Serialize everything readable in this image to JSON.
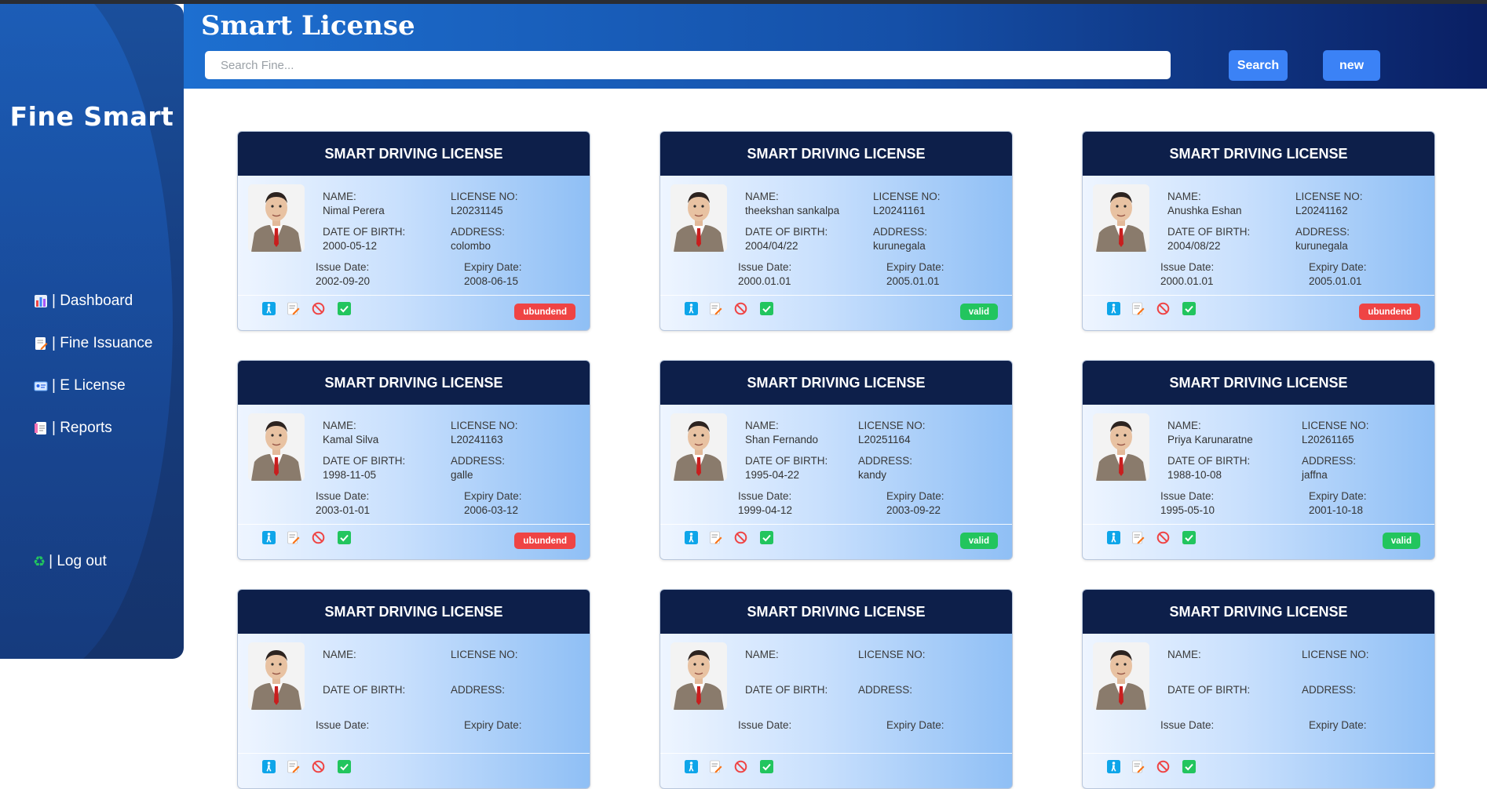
{
  "app": {
    "title": "Smart License"
  },
  "sidebar": {
    "brand": "Fine Smart",
    "items": [
      {
        "label": "| Dashboard",
        "icon": "bar-chart-icon"
      },
      {
        "label": "| Fine Issuance",
        "icon": "document-edit-icon"
      },
      {
        "label": "| E License",
        "icon": "id-card-icon"
      },
      {
        "label": "| Reports",
        "icon": "report-icon"
      }
    ],
    "logout": {
      "label": "| Log out",
      "icon": "recycle-icon"
    }
  },
  "search": {
    "placeholder": "Search Fine...",
    "value": ""
  },
  "buttons": {
    "search": "Search",
    "new": "new"
  },
  "card_labels": {
    "header": "SMART DRIVING LICENSE",
    "name": "NAME:",
    "license_no": "LICENSE NO:",
    "dob": "DATE OF BIRTH:",
    "address": "ADDRESS:",
    "issue": "Issue Date:",
    "expiry": "Expiry Date:"
  },
  "status_colors": {
    "valid": "#22c55e",
    "ubundend": "#ef4444"
  },
  "licenses": [
    {
      "name": "Nimal Perera",
      "license_no": "L20231145",
      "dob": "2000-05-12",
      "address": "colombo",
      "issue": "2002-09-20",
      "expiry": "2008-06-15",
      "status": "ubundend"
    },
    {
      "name": "theekshan sankalpa",
      "license_no": "L20241161",
      "dob": "2004/04/22",
      "address": "kurunegala",
      "issue": "2000.01.01",
      "expiry": "2005.01.01",
      "status": "valid"
    },
    {
      "name": "Anushka Eshan",
      "license_no": "L20241162",
      "dob": "2004/08/22",
      "address": "kurunegala",
      "issue": "2000.01.01",
      "expiry": "2005.01.01",
      "status": "ubundend"
    },
    {
      "name": "Kamal Silva",
      "license_no": "L20241163",
      "dob": "1998-11-05",
      "address": "galle",
      "issue": "2003-01-01",
      "expiry": "2006-03-12",
      "status": "ubundend"
    },
    {
      "name": "Shan Fernando",
      "license_no": "L20251164",
      "dob": "1995-04-22",
      "address": "kandy",
      "issue": "1999-04-12",
      "expiry": "2003-09-22",
      "status": "valid"
    },
    {
      "name": "Priya Karunaratne",
      "license_no": "L20261165",
      "dob": "1988-10-08",
      "address": "jaffna",
      "issue": "1995-05-10",
      "expiry": "2001-10-18",
      "status": "valid"
    },
    {
      "name": "",
      "license_no": "",
      "dob": "",
      "address": "",
      "issue": "",
      "expiry": "",
      "status": ""
    },
    {
      "name": "",
      "license_no": "",
      "dob": "",
      "address": "",
      "issue": "",
      "expiry": "",
      "status": ""
    },
    {
      "name": "",
      "license_no": "",
      "dob": "",
      "address": "",
      "issue": "",
      "expiry": "",
      "status": ""
    }
  ]
}
